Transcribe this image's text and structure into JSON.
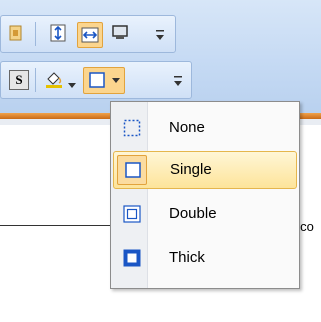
{
  "toolbar": {
    "row1_icons": [
      "page-icon",
      "row-height-icon",
      "column-width-icon",
      "monitor-icon",
      "overflow-arrow-icon"
    ],
    "row2_icons": [
      "style-s-icon",
      "fill-color-icon",
      "border-icon",
      "overflow-arrow-icon"
    ],
    "bold_s_label": "S"
  },
  "document": {
    "clipped_text": "elco"
  },
  "border_menu": {
    "items": [
      {
        "label": "None",
        "icon": "border-none-icon"
      },
      {
        "label": "Single",
        "icon": "border-single-icon",
        "selected": true
      },
      {
        "label": "Double",
        "icon": "border-double-icon"
      },
      {
        "label": "Thick",
        "icon": "border-thick-icon"
      }
    ]
  },
  "colors": {
    "ribbon": "#c4d9f3",
    "accent_orange": "#e08a2e",
    "highlight": "#fde49a"
  }
}
